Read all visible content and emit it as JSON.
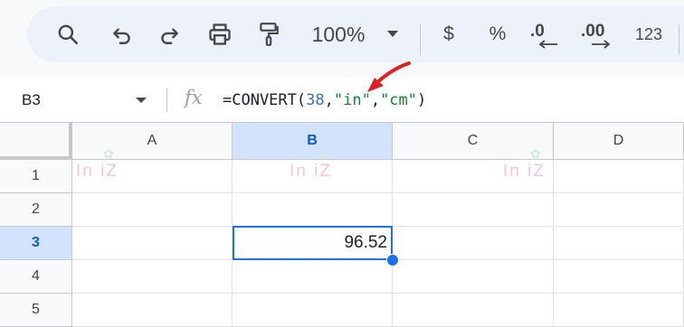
{
  "toolbar": {
    "zoom_label": "100%",
    "currency_label": "$",
    "percent_label": "%",
    "decrease_decimal_label": ".0",
    "increase_decimal_label": ".00",
    "more_formats_label": "123"
  },
  "formula_bar": {
    "name_box": "B3",
    "fx_label": "fx",
    "formula": {
      "prefix": "=CONVERT(",
      "number": "38",
      "comma1": ",",
      "from_unit": "\"in\"",
      "comma2": ",",
      "to_unit": "\"cm\"",
      "suffix": ")"
    }
  },
  "grid": {
    "columns": [
      "A",
      "B",
      "C",
      "D"
    ],
    "rows": [
      "1",
      "2",
      "3",
      "4",
      "5"
    ],
    "selected_cell": {
      "ref": "B3",
      "value": "96.52"
    }
  },
  "watermark": {
    "text": "In  iZ"
  },
  "colors": {
    "accent": "#1a73e8",
    "selected_header_bg": "#d3e3fd",
    "toolbar_bg": "#edf2fa",
    "annotation_arrow": "#e02020"
  }
}
